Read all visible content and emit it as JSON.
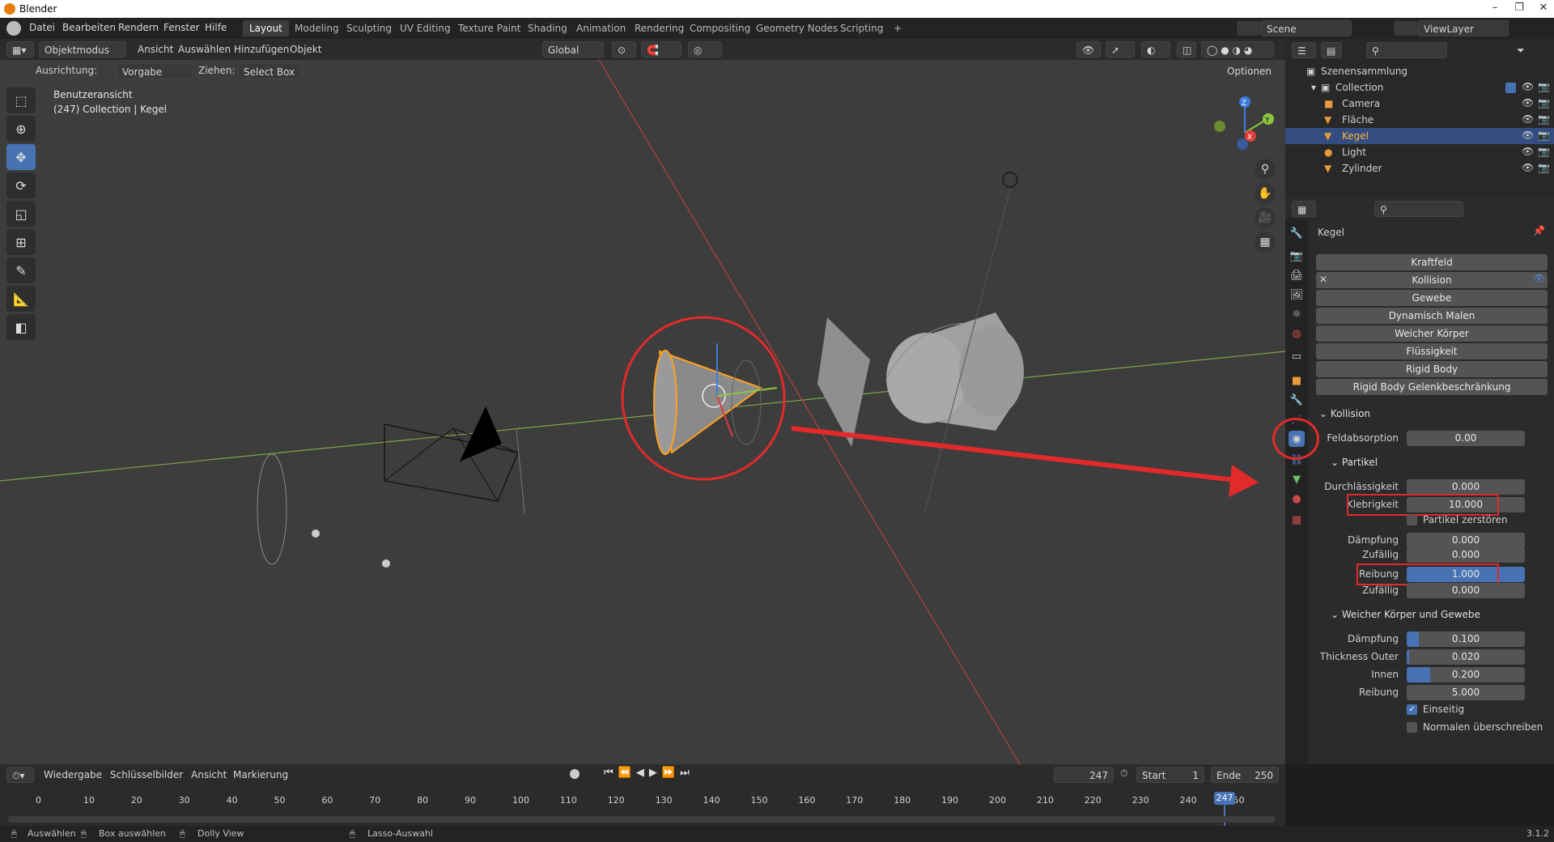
{
  "titlebar": {
    "title": "Blender"
  },
  "menu": [
    "Datei",
    "Bearbeiten",
    "Rendern",
    "Fenster",
    "Hilfe"
  ],
  "workspaces": [
    "Layout",
    "Modeling",
    "Sculpting",
    "UV Editing",
    "Texture Paint",
    "Shading",
    "Animation",
    "Rendering",
    "Compositing",
    "Geometry Nodes",
    "Scripting"
  ],
  "scene": {
    "scene_name": "Scene",
    "view_layer": "ViewLayer"
  },
  "viewport_header": {
    "mode": "Objektmodus",
    "menus": [
      "Ansicht",
      "Auswählen",
      "Hinzufügen",
      "Objekt"
    ],
    "orientation": "Global"
  },
  "tool_header": {
    "orientation_label": "Ausrichtung:",
    "orientation_value": "Vorgabe",
    "drag_label": "Ziehen:",
    "drag_value": "Select Box",
    "options": "Optionen"
  },
  "viewport": {
    "view_name": "Benutzeransicht",
    "collection_info": "(247) Collection | Kegel"
  },
  "outliner": {
    "root": "Szenensammlung",
    "collection": "Collection",
    "items": [
      "Camera",
      "Fläche",
      "Kegel",
      "Light",
      "Zylinder"
    ],
    "selected": "Kegel"
  },
  "properties": {
    "object_name": "Kegel",
    "physics_buttons": [
      "Kraftfeld",
      "Kollision",
      "Gewebe",
      "Dynamisch Malen",
      "Weicher Körper",
      "Flüssigkeit",
      "Rigid Body",
      "Rigid Body Gelenkbeschränkung"
    ],
    "collision_section": "Kollision",
    "field_absorption": {
      "label": "Feldabsorption",
      "value": "0.00"
    },
    "particle_section": "Partikel",
    "permeability": {
      "label": "Durchlässigkeit",
      "value": "0.000"
    },
    "stickiness": {
      "label": "Klebrigkeit",
      "value": "10.000"
    },
    "kill_particles": {
      "label": "Partikel zerstören",
      "checked": false
    },
    "damping": {
      "label": "Dämpfung",
      "value": "0.000"
    },
    "damping_random": {
      "label": "Zufällig",
      "value": "0.000"
    },
    "friction": {
      "label": "Reibung",
      "value": "1.000"
    },
    "friction_random": {
      "label": "Zufällig",
      "value": "0.000"
    },
    "softbody_section": "Weicher Körper und Gewebe",
    "sb_damping": {
      "label": "Dämpfung",
      "value": "0.100",
      "level": 0.1
    },
    "thickness_outer": {
      "label": "Thickness Outer",
      "value": "0.020",
      "level": 0.02
    },
    "inner": {
      "label": "Innen",
      "value": "0.200",
      "level": 0.2
    },
    "sb_friction": {
      "label": "Reibung",
      "value": "5.000"
    },
    "single_sided": {
      "label": "Einseitig",
      "checked": true
    },
    "override_normals": {
      "label": "Normalen überschreiben",
      "checked": false
    }
  },
  "timeline": {
    "menus": [
      "Wiedergabe",
      "Schlüsselbilder",
      "Ansicht",
      "Markierung"
    ],
    "current_frame": "247",
    "start_label": "Start",
    "start": "1",
    "end_label": "Ende",
    "end": "250",
    "ticks": [
      "0",
      "10",
      "20",
      "30",
      "40",
      "50",
      "60",
      "70",
      "80",
      "90",
      "100",
      "110",
      "120",
      "130",
      "140",
      "150",
      "160",
      "170",
      "180",
      "190",
      "200",
      "210",
      "220",
      "230",
      "240",
      "250"
    ],
    "playhead": "247"
  },
  "statusbar": {
    "items": [
      "Auswählen",
      "Box auswählen",
      "Dolly View",
      "Lasso-Auswahl"
    ],
    "version": "3.1.2"
  },
  "colors": {
    "accent": "#4772b3",
    "annotation": "#e22a2a",
    "selection": "#334d80"
  }
}
